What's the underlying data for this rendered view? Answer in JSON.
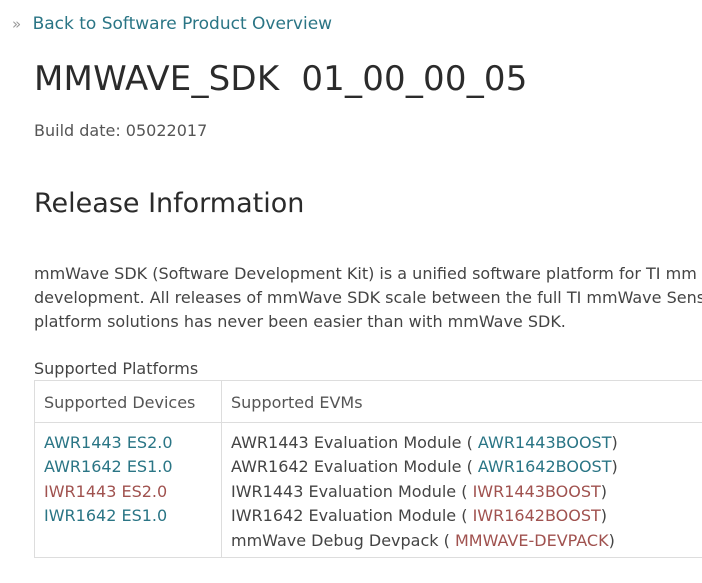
{
  "back_link": {
    "chevron": "»",
    "label": "Back to Software Product Overview"
  },
  "page_title": "MMWAVE_SDK  01_00_00_05",
  "build_date": "Build date: 05022017",
  "release_section": {
    "heading": "Release Information",
    "description_lines": [
      "mmWave SDK (Software Development Kit) is a unified software platform for TI mm",
      "development. All releases of mmWave SDK scale between the full TI mmWave Sens",
      "platform solutions has never been easier than with mmWave SDK."
    ]
  },
  "supported_platforms": {
    "heading": "Supported Platforms",
    "headers": [
      "Supported Devices",
      "Supported EVMs"
    ],
    "devices": [
      {
        "label": "AWR1443 ES2.0",
        "color": "#2a7585"
      },
      {
        "label": "AWR1642 ES1.0",
        "color": "#2a7585"
      },
      {
        "label": "IWR1443 ES2.0",
        "color": "#a0524f"
      },
      {
        "label": "IWR1642 ES1.0",
        "color": "#2a7585"
      }
    ],
    "evms": [
      {
        "prefix": "AWR1443 Evaluation Module ( ",
        "link": "AWR1443BOOST",
        "suffix": ")",
        "color": "#2a7585"
      },
      {
        "prefix": "AWR1642 Evaluation Module ( ",
        "link": "AWR1642BOOST",
        "suffix": ")",
        "color": "#2a7585"
      },
      {
        "prefix": "IWR1443 Evaluation Module ( ",
        "link": "IWR1443BOOST",
        "suffix": ")",
        "color": "#a0524f"
      },
      {
        "prefix": "IWR1642 Evaluation Module ( ",
        "link": "IWR1642BOOST",
        "suffix": ")",
        "color": "#a0524f"
      },
      {
        "prefix": "mmWave Debug Devpack ( ",
        "link": "MMWAVE-DEVPACK",
        "suffix": ")",
        "color": "#a0524f"
      }
    ]
  },
  "colors": {
    "link_teal": "#2a7585",
    "link_visited": "#a0524f",
    "text": "#444444",
    "heading": "#2b2b2b",
    "border": "#dddddd"
  }
}
